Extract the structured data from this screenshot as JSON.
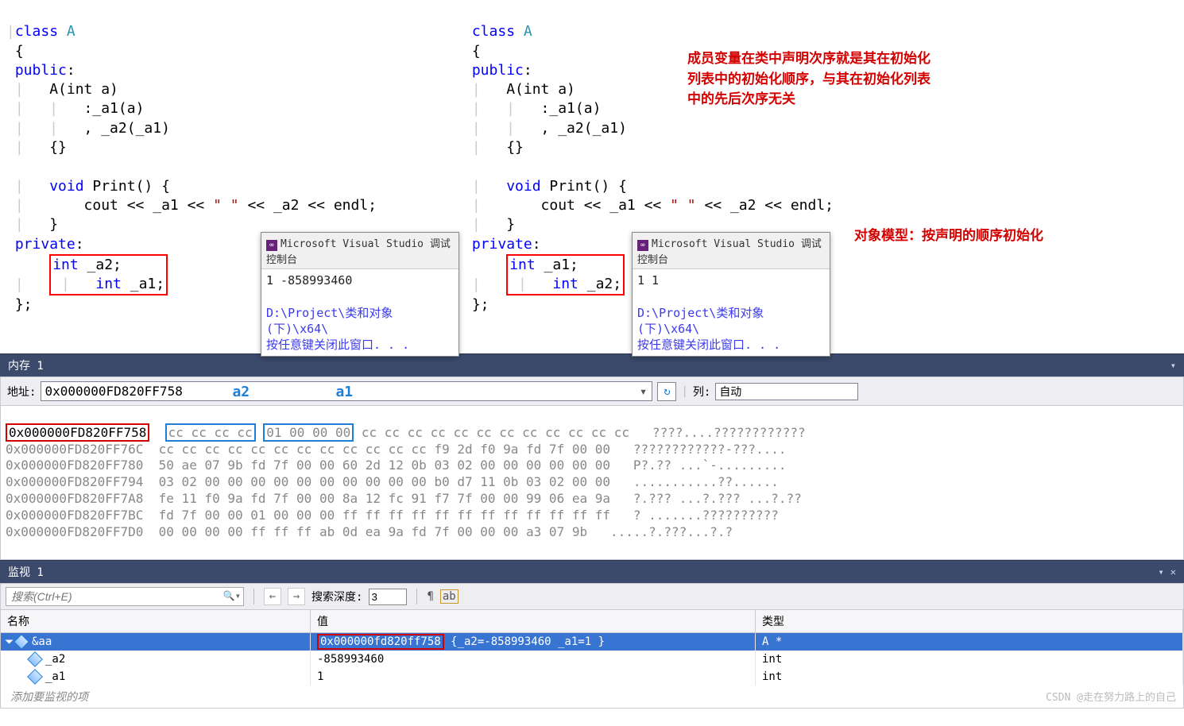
{
  "annotations": {
    "note1": "成员变量在类中声明次序就是其在初始化\n列表中的初始化顺序，与其在初始化列表\n中的先后次序无关",
    "note2": "对象模型：按声明的顺序初始化"
  },
  "code_left": {
    "class_decl": "class",
    "class_name": "A",
    "access_public": "public",
    "ctor_sig": "A(int a)",
    "init1": ":_a1(a)",
    "init2": ", _a2(_a1)",
    "print_sig": "void Print() {",
    "print_body": "    cout << _a1 << \" \" << _a2 << endl;",
    "access_private": "private",
    "field1": "int _a2;",
    "field2": "int _a1;"
  },
  "code_right": {
    "class_decl": "class",
    "class_name": "A",
    "access_public": "public",
    "ctor_sig": "A(int a)",
    "init1": ":_a1(a)",
    "init2": ", _a2(_a1)",
    "print_sig": "void Print() {",
    "print_body": "    cout << _a1 << \" \" << _a2 << endl;",
    "access_private": "private",
    "field1": "int _a1;",
    "field2": "int _a2;"
  },
  "console1": {
    "title": "Microsoft Visual Studio 调试控制台",
    "output": "1 -858993460",
    "path": "D:\\Project\\类和对象(下)\\x64\\",
    "press": "按任意键关闭此窗口. . ."
  },
  "console2": {
    "title": "Microsoft Visual Studio 调试控制台",
    "output": "1 1",
    "path": "D:\\Project\\类和对象(下)\\x64\\",
    "press": "按任意键关闭此窗口. . ."
  },
  "memory": {
    "panel_title": "内存 1",
    "addr_label": "地址:",
    "addr_value": "0x000000FD820FF758",
    "overlay_a2": "a2",
    "overlay_a1": "a1",
    "cols_label": "列:",
    "cols_value": "自动",
    "rows": [
      {
        "addr": "0x000000FD820FF758",
        "bytes_a": "cc cc cc cc",
        "bytes_b": "01 00 00 00",
        "bytes_rest": "cc cc cc cc cc cc cc cc cc cc cc cc",
        "ascii": " ????....????????????"
      },
      {
        "addr": "0x000000FD820FF76C",
        "bytes": "cc cc cc cc cc cc cc cc cc cc cc cc f9 2d f0 9a fd 7f 00 00",
        "ascii": " ????????????-???...."
      },
      {
        "addr": "0x000000FD820FF780",
        "bytes": "50 ae 07 9b fd 7f 00 00 60 2d 12 0b 03 02 00 00 00 00 00 00",
        "ascii": " P?.?? ...`-........."
      },
      {
        "addr": "0x000000FD820FF794",
        "bytes": "03 02 00 00 00 00 00 00 00 00 00 00 b0 d7 11 0b 03 02 00 00",
        "ascii": " ...........??......"
      },
      {
        "addr": "0x000000FD820FF7A8",
        "bytes": "fe 11 f0 9a fd 7f 00 00 8a 12 fc 91 f7 7f 00 00 99 06 ea 9a",
        "ascii": " ?.??? ...?.??? ...?.??"
      },
      {
        "addr": "0x000000FD820FF7BC",
        "bytes": "fd 7f 00 00 01 00 00 00 ff ff ff ff ff ff ff ff ff ff ff ff",
        "ascii": " ? .......??????????"
      },
      {
        "addr": "0x000000FD820FF7D0",
        "bytes": "00 00 00 00 ff ff ff ab 0d ea 9a fd 7f 00 00 00 a3 07 9b",
        "ascii": " .....?.???...?.?"
      }
    ]
  },
  "watch": {
    "panel_title": "监视 1",
    "search_placeholder": "搜索(Ctrl+E)",
    "depth_label": "搜索深度:",
    "depth_value": "3",
    "columns": {
      "name": "名称",
      "value": "值",
      "type": "类型"
    },
    "rows": [
      {
        "name": "&aa",
        "value_addr": "0x000000fd820ff758",
        "value_rest": " {_a2=-858993460 _a1=1 }",
        "type": "A *",
        "level": 0,
        "sel": true
      },
      {
        "name": "_a2",
        "value": "-858993460",
        "type": "int",
        "level": 1,
        "sel": false
      },
      {
        "name": "_a1",
        "value": "1",
        "type": "int",
        "level": 1,
        "sel": false
      }
    ],
    "add_placeholder": "添加要监视的项"
  },
  "watermark": "CSDN @走在努力路上的自己"
}
